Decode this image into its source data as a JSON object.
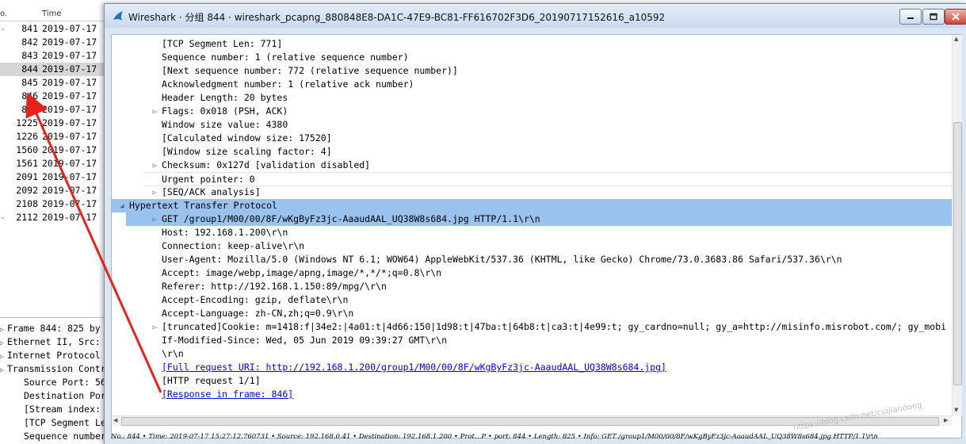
{
  "background_list": {
    "col_no": "o.",
    "col_time": "Time",
    "rows": [
      {
        "no": "841",
        "time": "2019-07-17",
        "dash": true
      },
      {
        "no": "842",
        "time": "2019-07-17"
      },
      {
        "no": "843",
        "time": "2019-07-17"
      },
      {
        "no": "844",
        "time": "2019-07-17",
        "selected": true
      },
      {
        "no": "845",
        "time": "2019-07-17"
      },
      {
        "no": "846",
        "time": "2019-07-17"
      },
      {
        "no": "850",
        "time": "2019-07-17"
      },
      {
        "no": "1225",
        "time": "2019-07-17"
      },
      {
        "no": "1226",
        "time": "2019-07-17"
      },
      {
        "no": "1560",
        "time": "2019-07-17"
      },
      {
        "no": "1561",
        "time": "2019-07-17"
      },
      {
        "no": "2091",
        "time": "2019-07-17"
      },
      {
        "no": "2092",
        "time": "2019-07-17"
      },
      {
        "no": "2108",
        "time": "2019-07-17"
      },
      {
        "no": "2112",
        "time": "2019-07-17",
        "dash": true
      }
    ]
  },
  "background_detail": [
    {
      "text": "Frame 844: 825 by",
      "indent": 0
    },
    {
      "text": "Ethernet II, Src:",
      "indent": 0
    },
    {
      "text": "Internet Protocol",
      "indent": 0
    },
    {
      "text": "Transmission Contr",
      "indent": 0
    },
    {
      "text": "Source Port: 56",
      "indent": 1
    },
    {
      "text": "Destination Por",
      "indent": 1
    },
    {
      "text": "[Stream index:",
      "indent": 1
    },
    {
      "text": "[TCP Segment Le",
      "indent": 1
    },
    {
      "text": "Sequence number",
      "indent": 1
    }
  ],
  "window": {
    "title": "Wireshark · 分组 844 · wireshark_pcapng_880848E8-DA1C-47E9-BC81-FF616702F3D6_20190717152616_a10592",
    "status": "No.: 844 • Time: 2019-07-17 15:27:12.760731 • Source: 192.168.0.41 • Destination: 192.168.1.200 • Prot…P • port: 844 • Length: 825 • Info: GET /group1/M00/00/8F/wKgByFz3jc-AaaudAAL_UQ38W8s684.jpg HTTP/1.1\\r\\n"
  },
  "tree": [
    {
      "text": "[TCP Segment Len: 771]",
      "level": 2
    },
    {
      "text": "Sequence number: 1    (relative sequence number)",
      "level": 2
    },
    {
      "text": "[Next sequence number: 772    (relative sequence number)]",
      "level": 2
    },
    {
      "text": "Acknowledgment number: 1    (relative ack number)",
      "level": 2
    },
    {
      "text": "Header Length: 20 bytes",
      "level": 2
    },
    {
      "text": "Flags: 0x018 (PSH, ACK)",
      "level": 2,
      "expander": "collapsed"
    },
    {
      "text": "Window size value: 4380",
      "level": 2
    },
    {
      "text": "[Calculated window size: 17520]",
      "level": 2
    },
    {
      "text": "[Window size scaling factor: 4]",
      "level": 2
    },
    {
      "text": "Checksum: 0x127d [validation disabled]",
      "level": 2,
      "expander": "collapsed"
    },
    {
      "text": "Urgent pointer: 0",
      "level": 2,
      "style": "bordered"
    },
    {
      "text": "[SEQ/ACK analysis]",
      "level": 2,
      "expander": "collapsed"
    },
    {
      "text": "Hypertext Transfer Protocol",
      "level": 1,
      "expander": "expanded",
      "style": "hl2"
    },
    {
      "text": "GET /group1/M00/00/8F/wKgByFz3jc-AaaudAAL_UQ38W8s684.jpg HTTP/1.1\\r\\n",
      "level": 2,
      "expander": "collapsed",
      "style": "hl"
    },
    {
      "text": "Host: 192.168.1.200\\r\\n",
      "level": 2
    },
    {
      "text": "Connection: keep-alive\\r\\n",
      "level": 2
    },
    {
      "text": "User-Agent: Mozilla/5.0 (Windows NT 6.1; WOW64) AppleWebKit/537.36 (KHTML, like Gecko) Chrome/73.0.3683.86 Safari/537.36\\r\\n",
      "level": 2
    },
    {
      "text": "Accept: image/webp,image/apng,image/*,*/*;q=0.8\\r\\n",
      "level": 2
    },
    {
      "text": "Referer: http://192.168.1.150:89/mpg/\\r\\n",
      "level": 2
    },
    {
      "text": "Accept-Encoding: gzip, deflate\\r\\n",
      "level": 2
    },
    {
      "text": "Accept-Language: zh-CN,zh;q=0.9\\r\\n",
      "level": 2
    },
    {
      "text": " [truncated]Cookie: m=1418:f|34e2:|4a01:t|4d66:150|1d98:t|47ba:t|64b8:t|ca3:t|4e99:t; gy_cardno=null; gy_a=http://misinfo.misrobot.com/; gy_mobi",
      "level": 2,
      "expander": "collapsed"
    },
    {
      "text": "If-Modified-Since: Wed, 05 Jun 2019 09:39:27 GMT\\r\\n",
      "level": 2
    },
    {
      "text": "\\r\\n",
      "level": 2
    },
    {
      "text": "[Full request URI: http://192.168.1.200/group1/M00/00/8F/wKgByFz3jc-AaaudAAL_UQ38W8s684.jpg]",
      "level": 2,
      "link": true
    },
    {
      "text": "[HTTP request 1/1]",
      "level": 2
    },
    {
      "text": "[Response in frame: 846]",
      "level": 2,
      "link": true
    }
  ],
  "watermark": "https://blog.csdn.net/cuijiandong",
  "colors": {
    "selection": "#99c2ee",
    "link": "#0000ee",
    "arrow": "#e8211c"
  },
  "icons": {
    "app": "wireshark-fin-icon",
    "min": "minimize-icon",
    "max": "maximize-icon",
    "close": "close-icon"
  }
}
